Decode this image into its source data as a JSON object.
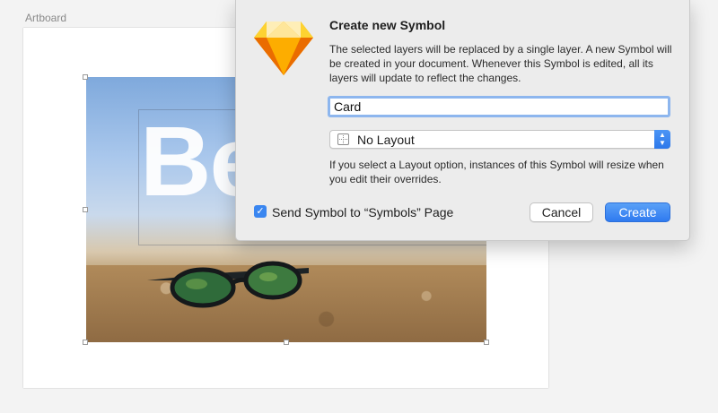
{
  "canvas": {
    "artboard_label": "Artboard",
    "image_text": "Be"
  },
  "dialog": {
    "title": "Create new Symbol",
    "description": "The selected layers will be replaced by a single layer. A new Symbol will be created in your document. Whenever this Symbol is edited, all its layers will update to reflect the changes.",
    "name_value": "Card",
    "layout_selected": "No Layout",
    "layout_hint": "If you select a Layout option, instances of this Symbol will resize when you edit their overrides.",
    "send_to_symbols_label": "Send Symbol to “Symbols” Page",
    "send_to_symbols_checked": true,
    "cancel_label": "Cancel",
    "create_label": "Create",
    "app_icon": "sketch-diamond-icon"
  },
  "colors": {
    "accent": "#3a86f0",
    "focus_ring": "#8db6ee",
    "dialog_bg": "#ececec"
  }
}
